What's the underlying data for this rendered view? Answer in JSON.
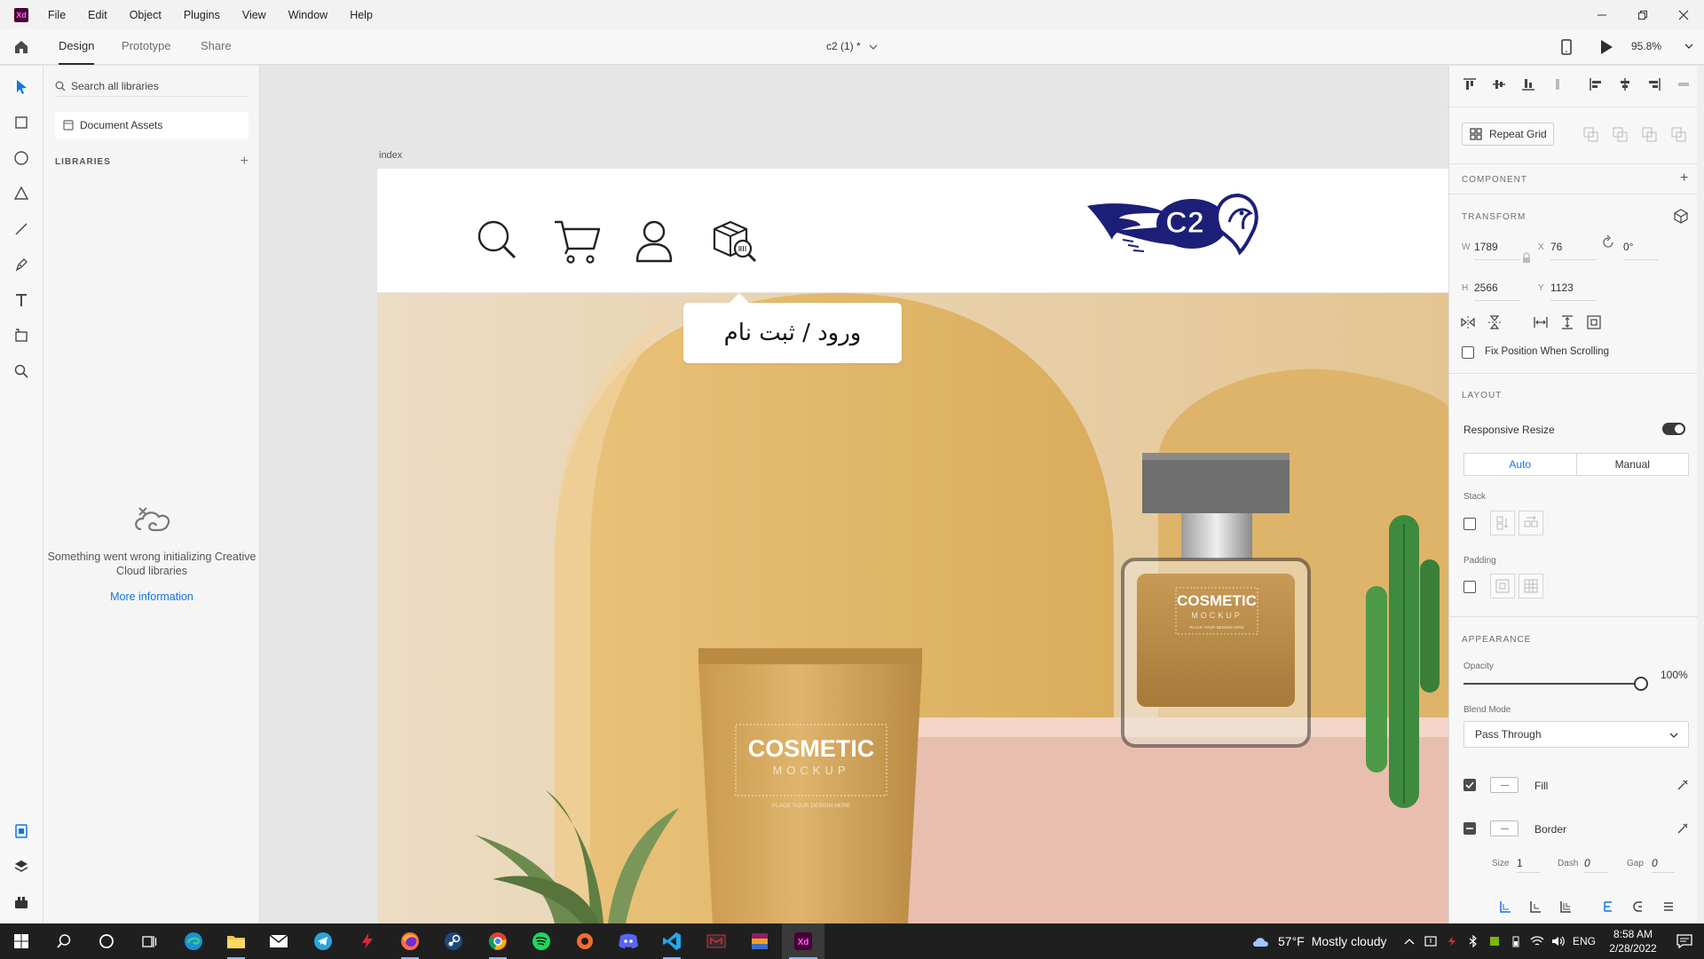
{
  "app": {
    "logo_text": "Xd",
    "menu": [
      "File",
      "Edit",
      "Object",
      "Plugins",
      "View",
      "Window",
      "Help"
    ]
  },
  "tabs": {
    "design": "Design",
    "prototype": "Prototype",
    "share": "Share"
  },
  "document": {
    "title": "c2 (1) *",
    "zoom": "95.8%"
  },
  "libraries": {
    "search_placeholder": "Search all libraries",
    "document_assets": "Document Assets",
    "section_label": "LIBRARIES",
    "error_message": "Something went wrong initializing Creative Cloud libraries",
    "more_info": "More information"
  },
  "canvas": {
    "artboard_label": "index",
    "tooltip_text": "ورود / ثبت نام",
    "brand_text": "C2",
    "products": {
      "tube_title": "COSMETIC",
      "tube_subtitle": "MOCKUP",
      "tube_tagline": "PLACE YOUR DESIGN HERE",
      "bottle_title": "COSMETIC",
      "bottle_subtitle": "MOCKUP",
      "bottle_tagline": "PLACE YOUR DESIGN HERE"
    }
  },
  "inspector": {
    "repeat_grid": "Repeat Grid",
    "component_title": "COMPONENT",
    "transform_title": "TRANSFORM",
    "w_label": "W",
    "w_value": "1789",
    "x_label": "X",
    "x_value": "76",
    "rotation_value": "0°",
    "h_label": "H",
    "h_value": "2566",
    "y_label": "Y",
    "y_value": "1123",
    "fix_position": "Fix Position When Scrolling",
    "layout_title": "LAYOUT",
    "responsive_resize": "Responsive Resize",
    "auto": "Auto",
    "manual": "Manual",
    "stack": "Stack",
    "padding": "Padding",
    "appearance_title": "APPEARANCE",
    "opacity_label": "Opacity",
    "opacity_value": "100%",
    "opacity_level": 1.0,
    "blend_mode_label": "Blend Mode",
    "blend_mode_value": "Pass Through",
    "fill_label": "Fill",
    "border_label": "Border",
    "size_label": "Size",
    "size_value": "1",
    "dash_label": "Dash",
    "dash_value": "0",
    "gap_label": "Gap",
    "gap_value": "0"
  },
  "taskbar": {
    "weather_temp": "57°F",
    "weather_desc": "Mostly cloudy",
    "lang": "ENG",
    "time": "8:58 AM",
    "date": "2/28/2022"
  },
  "colors": {
    "accent": "#1473e6",
    "xd_purple": "#470137",
    "xd_pink": "#ff61f6",
    "brand_navy": "#1c1f78",
    "hero_beige": "#e9dac3",
    "arch_mustard": "#e1b86a"
  }
}
